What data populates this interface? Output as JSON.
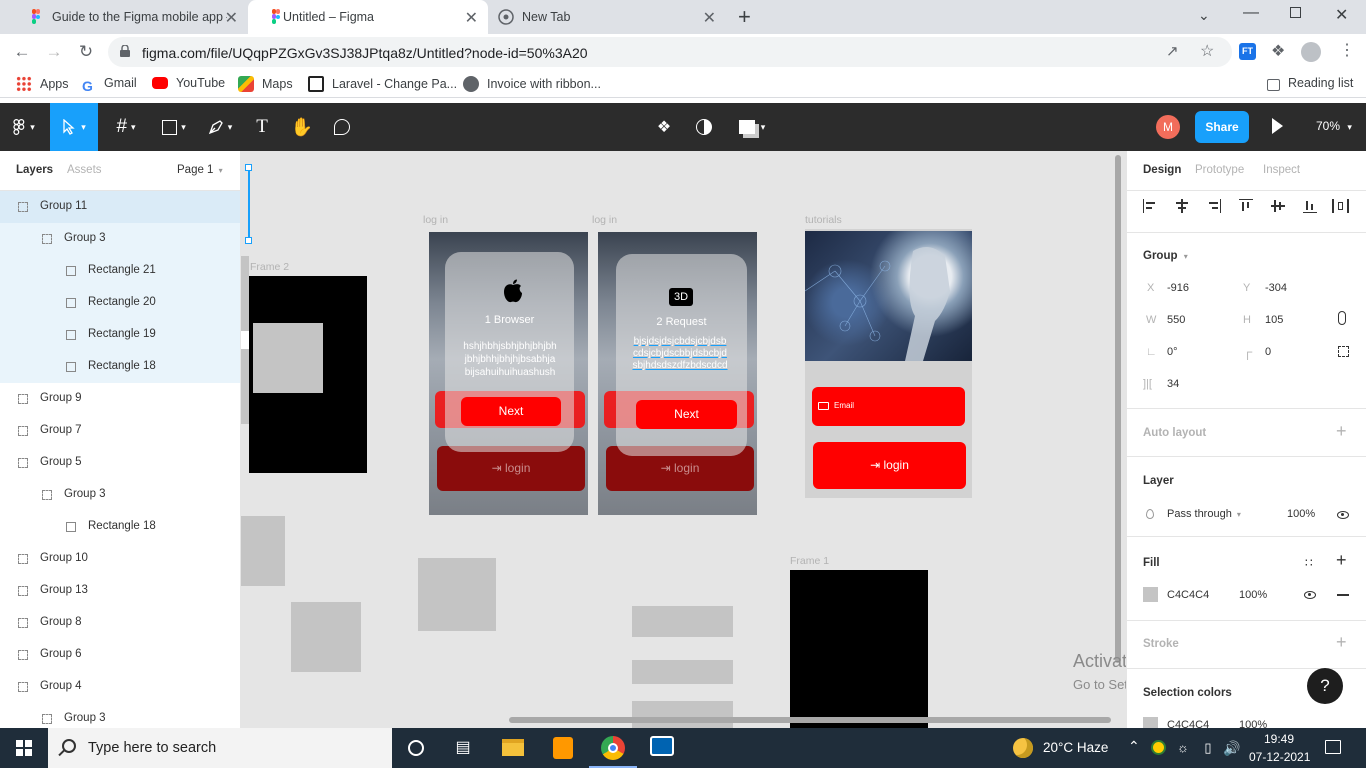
{
  "browser": {
    "tabs": [
      {
        "title": "Guide to the Figma mobile app –",
        "close": "✕"
      },
      {
        "title": "Untitled – Figma",
        "close": "✕"
      },
      {
        "title": "New Tab",
        "close": "✕"
      }
    ],
    "new_tab": "+",
    "url": "figma.com/file/UQqpPZGxGv3SJ38JPtqa8z/Untitled?node-id=50%3A20",
    "bookmarks": [
      "Apps",
      "Gmail",
      "YouTube",
      "Maps",
      "Laravel - Change Pa...",
      "Invoice with ribbon..."
    ],
    "reading_list": "Reading list",
    "ext_badge": "FT"
  },
  "figma_toolbar": {
    "share": "Share",
    "zoom": "70%",
    "avatar": "M"
  },
  "left_panel": {
    "tabs": {
      "layers": "Layers",
      "assets": "Assets",
      "page": "Page 1"
    },
    "layers": [
      {
        "name": "Group 11",
        "level": 0,
        "kind": "group",
        "selected": true
      },
      {
        "name": "Group 3",
        "level": 1,
        "kind": "group",
        "selected": true
      },
      {
        "name": "Rectangle 21",
        "level": 2,
        "kind": "rect",
        "selected": true
      },
      {
        "name": "Rectangle 20",
        "level": 2,
        "kind": "rect",
        "selected": true
      },
      {
        "name": "Rectangle 19",
        "level": 2,
        "kind": "rect",
        "selected": true
      },
      {
        "name": "Rectangle 18",
        "level": 2,
        "kind": "rect",
        "selected": true
      },
      {
        "name": "Group 9",
        "level": 0,
        "kind": "group"
      },
      {
        "name": "Group 7",
        "level": 0,
        "kind": "group"
      },
      {
        "name": "Group 5",
        "level": 0,
        "kind": "group"
      },
      {
        "name": "Group 3",
        "level": 1,
        "kind": "group"
      },
      {
        "name": "Rectangle 18",
        "level": 2,
        "kind": "rect"
      },
      {
        "name": "Group 10",
        "level": 0,
        "kind": "group"
      },
      {
        "name": "Group 13",
        "level": 0,
        "kind": "group"
      },
      {
        "name": "Group 8",
        "level": 0,
        "kind": "group"
      },
      {
        "name": "Group 6",
        "level": 0,
        "kind": "group"
      },
      {
        "name": "Group 4",
        "level": 0,
        "kind": "group"
      },
      {
        "name": "Group 3",
        "level": 1,
        "kind": "group"
      }
    ]
  },
  "canvas": {
    "frame2_label": "Frame 2",
    "frame1_label": "Frame 1",
    "login1": {
      "label": "log in",
      "title": "1 Browser",
      "body": "hshjhbhjsbhjbhjbhjbh jbhjbhhjbhjhjbsabhja bijsahuihuihuashush",
      "next": "Next",
      "login": "login"
    },
    "login2": {
      "label": "log in",
      "badge": "3D",
      "title": "2 Request",
      "body": "bjsjdsjdsjcbdsjcbjdsb cdsjcbjdscbbjdsbcbjd sbjhdsdszdfzbdscdcd",
      "next": "Next",
      "login": "login"
    },
    "tutorials": {
      "label": "tutorials",
      "email": "Email",
      "login": "login"
    },
    "watermark_title": "Activate Windows",
    "watermark_sub": "Go to Settings to activate Windows."
  },
  "right_panel": {
    "tabs": {
      "design": "Design",
      "prototype": "Prototype",
      "inspect": "Inspect"
    },
    "group_title": "Group",
    "x": "-916",
    "y": "-304",
    "w": "550",
    "h": "105",
    "rotation": "0°",
    "radius": "0",
    "spacing": "34",
    "auto_layout": "Auto layout",
    "layer_title": "Layer",
    "blend": "Pass through",
    "layer_opacity": "100%",
    "fill_title": "Fill",
    "fill_hex": "C4C4C4",
    "fill_opacity": "100%",
    "stroke_title": "Stroke",
    "selection_colors": "Selection colors",
    "sel_hex": "C4C4C4",
    "sel_opacity": "100%",
    "help": "?"
  },
  "taskbar": {
    "search_placeholder": "Type here to search",
    "weather": "20°C Haze",
    "time": "19:49",
    "date": "07-12-2021"
  },
  "colors": {
    "figma_blue": "#18a0fb",
    "toolbar_dark": "#2c2c2c",
    "accent_red": "#ff0000",
    "avatar": "#f24e1e"
  }
}
